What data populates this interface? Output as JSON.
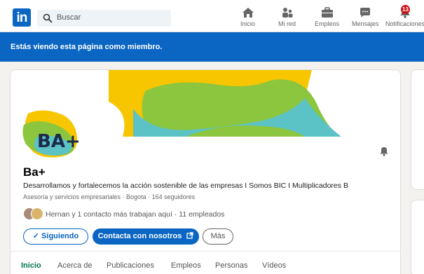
{
  "nav": {
    "logo_text": "in",
    "search_placeholder": "Buscar",
    "items": [
      {
        "label": "Inicio",
        "icon": "home-icon"
      },
      {
        "label": "Mi red",
        "icon": "network-icon"
      },
      {
        "label": "Empleos",
        "icon": "briefcase-icon"
      },
      {
        "label": "Mensajes",
        "icon": "messaging-icon"
      },
      {
        "label": "Notificaciones",
        "icon": "bell-icon",
        "badge": "13"
      }
    ]
  },
  "banner": {
    "text": "Estás viendo esta página como miembro."
  },
  "company": {
    "logo_text": "BA+",
    "name": "Ba+",
    "tagline": "Desarrollamos y fortalecemos la acción sostenible de las empresas I Somos BIC I Multiplicadores B",
    "meta": "Asesoría y servicios empresariales · Bogota · 164 seguidores",
    "connections": "Hernan y 1 contacto más trabajan aquí · 11 empleados"
  },
  "actions": {
    "follow_label": "✓ Siguiendo",
    "contact_label": "Contacta con nosotros",
    "more_label": "Más"
  },
  "tabs": [
    {
      "label": "Inicio",
      "active": true
    },
    {
      "label": "Acerca de"
    },
    {
      "label": "Publicaciones"
    },
    {
      "label": "Empleos"
    },
    {
      "label": "Personas"
    },
    {
      "label": "Vídeos"
    }
  ],
  "colors": {
    "brand": "#0a66c2",
    "active_tab": "#01754f",
    "notification": "#cc1016",
    "cover_yellow": "#f7c600",
    "cover_green": "#8cc63e",
    "cover_teal": "#5bc2c6"
  }
}
